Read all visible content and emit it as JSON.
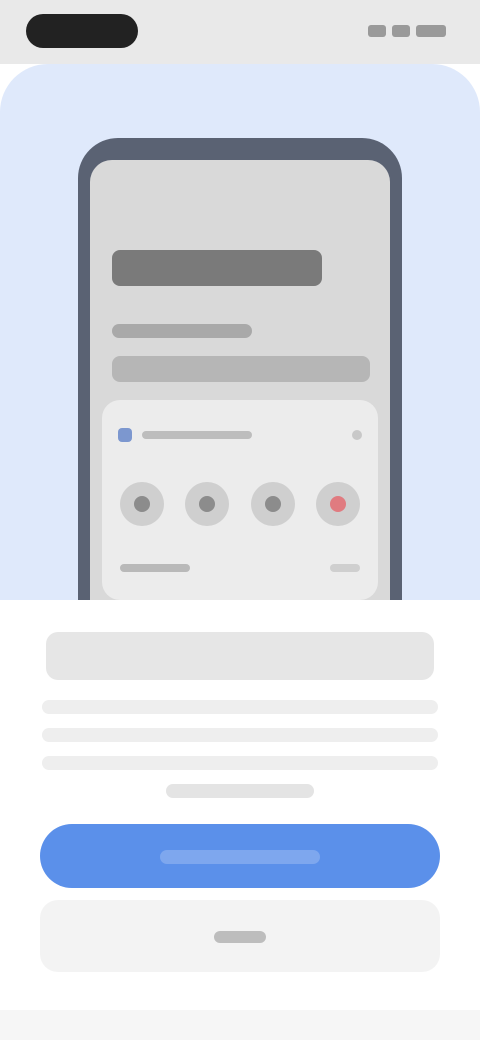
{
  "status_bar": {
    "pill_text": "",
    "right_indicators": [
      "signal",
      "wifi",
      "battery"
    ]
  },
  "hero": {
    "background_color": "#dfe9fb",
    "phone_mockup": {
      "frame_color": "#5a6273",
      "accent_color": "#7c97cf",
      "alert_color": "#e07b80"
    }
  },
  "sheet": {
    "headline": "",
    "body": ""
  },
  "actions": {
    "primary": {
      "label": "",
      "color": "#5b90ea"
    },
    "secondary": {
      "label": ""
    }
  }
}
